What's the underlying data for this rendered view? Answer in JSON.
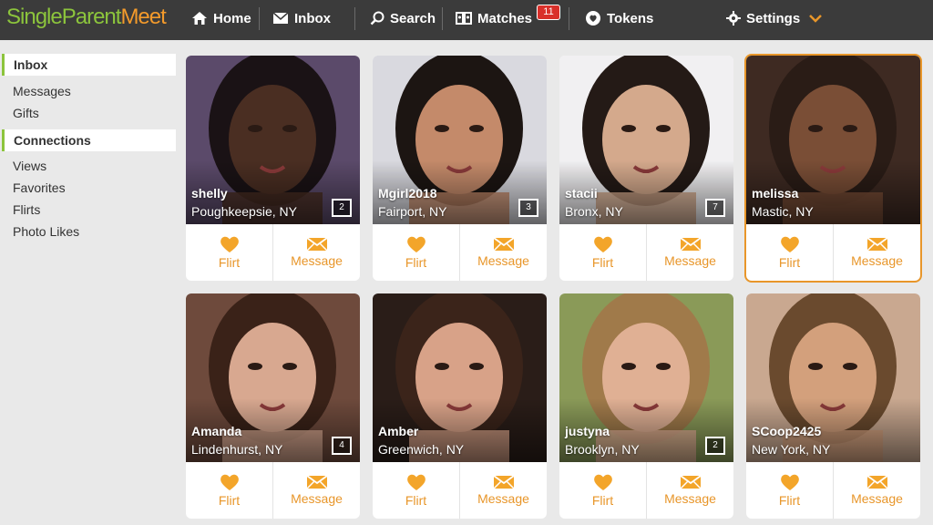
{
  "brand": {
    "part1": "SingleParent",
    "part2": "Meet"
  },
  "nav": {
    "home": "Home",
    "inbox": "Inbox",
    "search": "Search",
    "matches": "Matches",
    "matches_badge": "11",
    "tokens": "Tokens",
    "settings": "Settings"
  },
  "sidebar": {
    "inbox_header": "Inbox",
    "inbox_items": [
      "Messages",
      "Gifts"
    ],
    "connections_header": "Connections",
    "connection_items": [
      "Views",
      "Favorites",
      "Flirts",
      "Photo Likes"
    ]
  },
  "actions": {
    "flirt": "Flirt",
    "message": "Message"
  },
  "profiles": [
    {
      "name": "shelly",
      "location": "Poughkeepsie, NY",
      "photos": "2",
      "bg": "#5b4a6a",
      "skin": "#4a2e22",
      "hair": "#1a1215"
    },
    {
      "name": "Mgirl2018",
      "location": "Fairport, NY",
      "photos": "3",
      "bg": "#d9d9df",
      "skin": "#c48a6a",
      "hair": "#1c1512"
    },
    {
      "name": "stacii",
      "location": "Bronx, NY",
      "photos": "7",
      "bg": "#f1f0f2",
      "skin": "#d4a98c",
      "hair": "#241a16"
    },
    {
      "name": "melissa",
      "location": "Mastic, NY",
      "photos": "",
      "bg": "#3e2a22",
      "skin": "#7a4e36",
      "hair": "#2a1c16"
    },
    {
      "name": "Amanda",
      "location": "Lindenhurst, NY",
      "photos": "4",
      "bg": "#6e4a3c",
      "skin": "#d8a890",
      "hair": "#3a2218"
    },
    {
      "name": "Amber",
      "location": "Greenwich, NY",
      "photos": "",
      "bg": "#2a1d18",
      "skin": "#d8a288",
      "hair": "#3b241a"
    },
    {
      "name": "justyna",
      "location": "Brooklyn, NY",
      "photos": "2",
      "bg": "#8a9a58",
      "skin": "#e0b094",
      "hair": "#a07a4a"
    },
    {
      "name": "SCoop2425",
      "location": "New York, NY",
      "photos": "",
      "bg": "#c9a890",
      "skin": "#d3a07c",
      "hair": "#6a4a2e"
    }
  ],
  "colors": {
    "accent": "#e8962a",
    "green": "#8cc43c",
    "topbar": "#3b3b3b"
  }
}
